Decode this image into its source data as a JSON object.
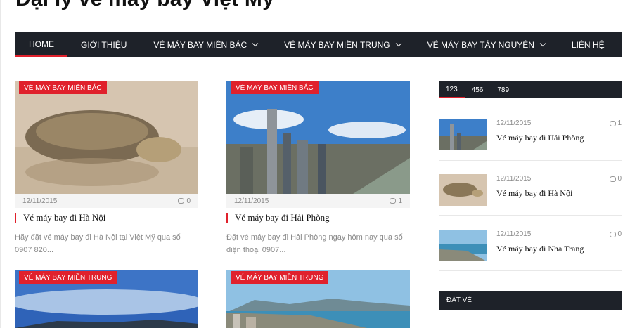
{
  "site": {
    "title": "Đại lý vé máy bay Việt Mỹ"
  },
  "nav": {
    "items": [
      {
        "label": "HOME"
      },
      {
        "label": "GIỚI THIỆU"
      },
      {
        "label": "VÉ MÁY BAY MIỀN BẮC"
      },
      {
        "label": "VÉ MÁY BAY MIỀN TRUNG"
      },
      {
        "label": "VÉ MÁY BAY TÂY NGUYÊN"
      },
      {
        "label": "LIÊN HỆ"
      }
    ]
  },
  "posts": [
    {
      "category": "VÉ MÁY BAY MIỀN BẮC",
      "date": "12/11/2015",
      "comments": "0",
      "title": "Vé máy bay đi Hà Nội",
      "excerpt": "Hãy đặt vé máy bay đi Hà Nội tại Việt Mỹ qua số 0907 820..."
    },
    {
      "category": "VÉ MÁY BAY MIỀN BẮC",
      "date": "12/11/2015",
      "comments": "1",
      "title": "Vé máy bay đi Hải Phòng",
      "excerpt": "Đặt vé máy bay đi Hải Phòng ngay hôm nay qua số điện thoại 0907..."
    },
    {
      "category": "VÉ MÁY BAY MIỀN TRUNG"
    },
    {
      "category": "VÉ MÁY BAY MIỀN TRUNG"
    }
  ],
  "sidebar": {
    "tabs": [
      {
        "label": "123"
      },
      {
        "label": "456"
      },
      {
        "label": "789"
      }
    ],
    "items": [
      {
        "date": "12/11/2015",
        "count": "1",
        "title": "Vé máy bay đi Hải Phòng"
      },
      {
        "date": "12/11/2015",
        "count": "0",
        "title": "Vé máy bay đi Hà Nội"
      },
      {
        "date": "12/11/2015",
        "count": "0",
        "title": "Vé máy bay đi Nha Trang"
      }
    ],
    "widget_title": "ĐẶT VÉ"
  },
  "colors": {
    "accent": "#e0212c",
    "dark": "#1e2229"
  }
}
